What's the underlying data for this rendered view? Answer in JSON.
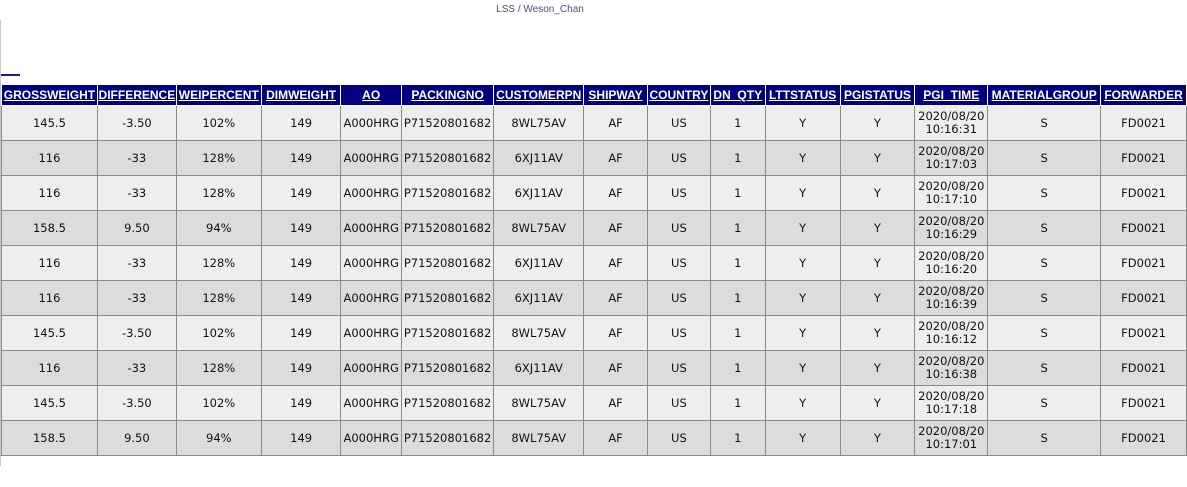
{
  "header": {
    "breadcrumb": "LSS / Weson_Chan"
  },
  "table": {
    "columns": [
      "GROSSWEIGHT",
      "DIFFERENCE",
      "WEIPERCENT",
      "DIMWEIGHT",
      "AO",
      "PACKINGNO",
      "CUSTOMERPN",
      "SHIPWAY",
      "COUNTRY",
      "DN_QTY",
      "LTTSTATUS",
      "PGISTATUS",
      "PGI_TIME",
      "MATERIALGROUP",
      "FORWARDER"
    ],
    "rows": [
      [
        "145.5",
        "-3.50",
        "102%",
        "149",
        "A000HRG",
        "P71520801682",
        "8WL75AV",
        "AF",
        "US",
        "1",
        "Y",
        "Y",
        "2020/08/20 10:16:31",
        "S",
        "FD0021"
      ],
      [
        "116",
        "-33",
        "128%",
        "149",
        "A000HRG",
        "P71520801682",
        "6XJ11AV",
        "AF",
        "US",
        "1",
        "Y",
        "Y",
        "2020/08/20 10:17:03",
        "S",
        "FD0021"
      ],
      [
        "116",
        "-33",
        "128%",
        "149",
        "A000HRG",
        "P71520801682",
        "6XJ11AV",
        "AF",
        "US",
        "1",
        "Y",
        "Y",
        "2020/08/20 10:17:10",
        "S",
        "FD0021"
      ],
      [
        "158.5",
        "9.50",
        "94%",
        "149",
        "A000HRG",
        "P71520801682",
        "8WL75AV",
        "AF",
        "US",
        "1",
        "Y",
        "Y",
        "2020/08/20 10:16:29",
        "S",
        "FD0021"
      ],
      [
        "116",
        "-33",
        "128%",
        "149",
        "A000HRG",
        "P71520801682",
        "6XJ11AV",
        "AF",
        "US",
        "1",
        "Y",
        "Y",
        "2020/08/20 10:16:20",
        "S",
        "FD0021"
      ],
      [
        "116",
        "-33",
        "128%",
        "149",
        "A000HRG",
        "P71520801682",
        "6XJ11AV",
        "AF",
        "US",
        "1",
        "Y",
        "Y",
        "2020/08/20 10:16:39",
        "S",
        "FD0021"
      ],
      [
        "145.5",
        "-3.50",
        "102%",
        "149",
        "A000HRG",
        "P71520801682",
        "8WL75AV",
        "AF",
        "US",
        "1",
        "Y",
        "Y",
        "2020/08/20 10:16:12",
        "S",
        "FD0021"
      ],
      [
        "116",
        "-33",
        "128%",
        "149",
        "A000HRG",
        "P71520801682",
        "6XJ11AV",
        "AF",
        "US",
        "1",
        "Y",
        "Y",
        "2020/08/20 10:16:38",
        "S",
        "FD0021"
      ],
      [
        "145.5",
        "-3.50",
        "102%",
        "149",
        "A000HRG",
        "P71520801682",
        "8WL75AV",
        "AF",
        "US",
        "1",
        "Y",
        "Y",
        "2020/08/20 10:17:18",
        "S",
        "FD0021"
      ],
      [
        "158.5",
        "9.50",
        "94%",
        "149",
        "A000HRG",
        "P71520801682",
        "8WL75AV",
        "AF",
        "US",
        "1",
        "Y",
        "Y",
        "2020/08/20 10:17:01",
        "S",
        "FD0021"
      ]
    ]
  },
  "colors": {
    "header_bg": "#000080",
    "header_text": "#ffffff",
    "row_odd": "#eeeeee",
    "row_even": "#dcdcdc",
    "link": "#1a1aa0"
  }
}
